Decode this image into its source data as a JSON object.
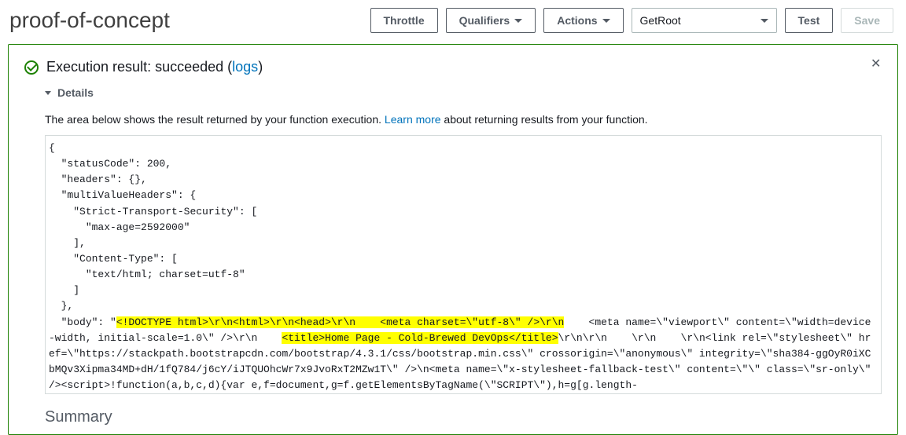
{
  "header": {
    "title": "proof-of-concept",
    "buttons": {
      "throttle": "Throttle",
      "qualifiers": "Qualifiers",
      "actions": "Actions",
      "test": "Test",
      "save": "Save"
    },
    "select_value": "GetRoot"
  },
  "result": {
    "prefix": "Execution result: ",
    "status": "succeeded",
    "logs_link": "logs",
    "details_label": "Details",
    "desc_before": "The area below shows the result returned by your function execution. ",
    "learn_more": "Learn more",
    "desc_after": " about returning results from your function.",
    "summary_label": "Summary"
  },
  "code": {
    "pre_a": "{\n  \"statusCode\": 200,\n  \"headers\": {},\n  \"multiValueHeaders\": {\n    \"Strict-Transport-Security\": [\n      \"max-age=2592000\"\n    ],\n    \"Content-Type\": [\n      \"text/html; charset=utf-8\"\n    ]\n  },\n  \"body\": \"",
    "hl_a": "<!DOCTYPE html>\\r\\n<html>\\r\\n<head>\\r\\n    <meta charset=\\\"utf-8\\\" />\\r\\n",
    "mid_a": "    <meta name=\\\"viewport\\\" content=\\\"width=device-width, initial-scale=1.0\\\" />\\r\\n    ",
    "hl_b": "<title>Home Page - Cold-Brewed DevOps</title>",
    "post_a": "\\r\\n\\r\\n    \\r\\n    \\r\\n<link rel=\\\"stylesheet\\\" href=\\\"https://stackpath.bootstrapcdn.com/bootstrap/4.3.1/css/bootstrap.min.css\\\" crossorigin=\\\"anonymous\\\" integrity=\\\"sha384-ggOyR0iXCbMQv3Xipma34MD+dH/1fQ784/j6cY/iJTQUOhcWr7x9JvoRxT2MZw1T\\\" />\\n<meta name=\\\"x-stylesheet-fallback-test\\\" content=\\\"\\\" class=\\\"sr-only\\\" /><script>!function(a,b,c,d){var e,f=document,g=f.getElementsByTagName(\\\"SCRIPT\\\"),h=g[g.length-"
  }
}
